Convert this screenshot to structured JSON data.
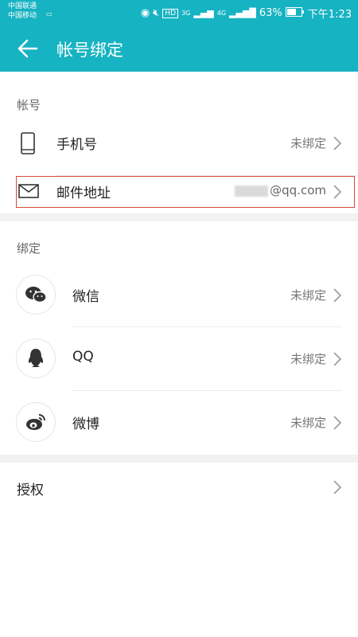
{
  "status": {
    "carrier1": "中国联通",
    "carrier2": "中国移动",
    "network1": "3G",
    "network2": "4G",
    "battery": "63%",
    "time": "下午1:23",
    "hd_label": "HD"
  },
  "header": {
    "title": "帐号绑定"
  },
  "account_section": {
    "label": "帐号",
    "items": [
      {
        "label": "手机号",
        "value": "未绑定"
      },
      {
        "label": "邮件地址",
        "value": "@qq.com"
      }
    ]
  },
  "binding_section": {
    "label": "绑定",
    "items": [
      {
        "label": "微信",
        "value": "未绑定"
      },
      {
        "label": "QQ",
        "value": "未绑定"
      },
      {
        "label": "微博",
        "value": "未绑定"
      }
    ]
  },
  "authorization": {
    "label": "授权"
  },
  "colors": {
    "accent": "#16b3c2",
    "highlight": "#d64b3b"
  }
}
